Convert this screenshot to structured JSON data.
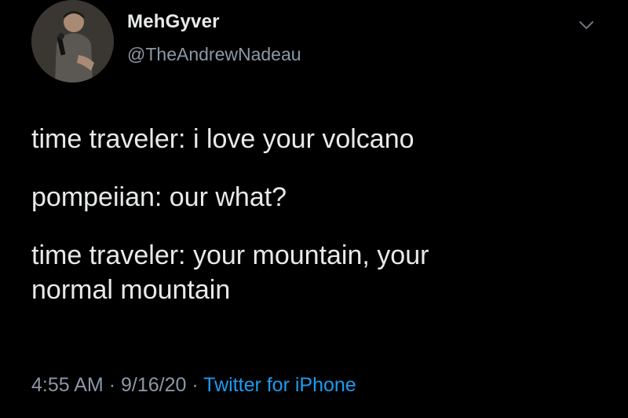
{
  "tweet": {
    "display_name": "MehGyver",
    "handle": "@TheAndrewNadeau",
    "lines": [
      "time traveler: i love your volcano",
      "pompeiian: our what?",
      "time traveler: your mountain, your",
      "normal mountain"
    ],
    "time": "4:55 AM",
    "separator": "·",
    "date": "9/16/20",
    "source": "Twitter for iPhone"
  },
  "colors": {
    "background": "#000000",
    "text": "#e7e9ea",
    "secondary": "#8b98a5",
    "accent": "#1d9bf0"
  },
  "icons": {
    "menu": "chevron-down-icon",
    "avatar": "avatar"
  }
}
